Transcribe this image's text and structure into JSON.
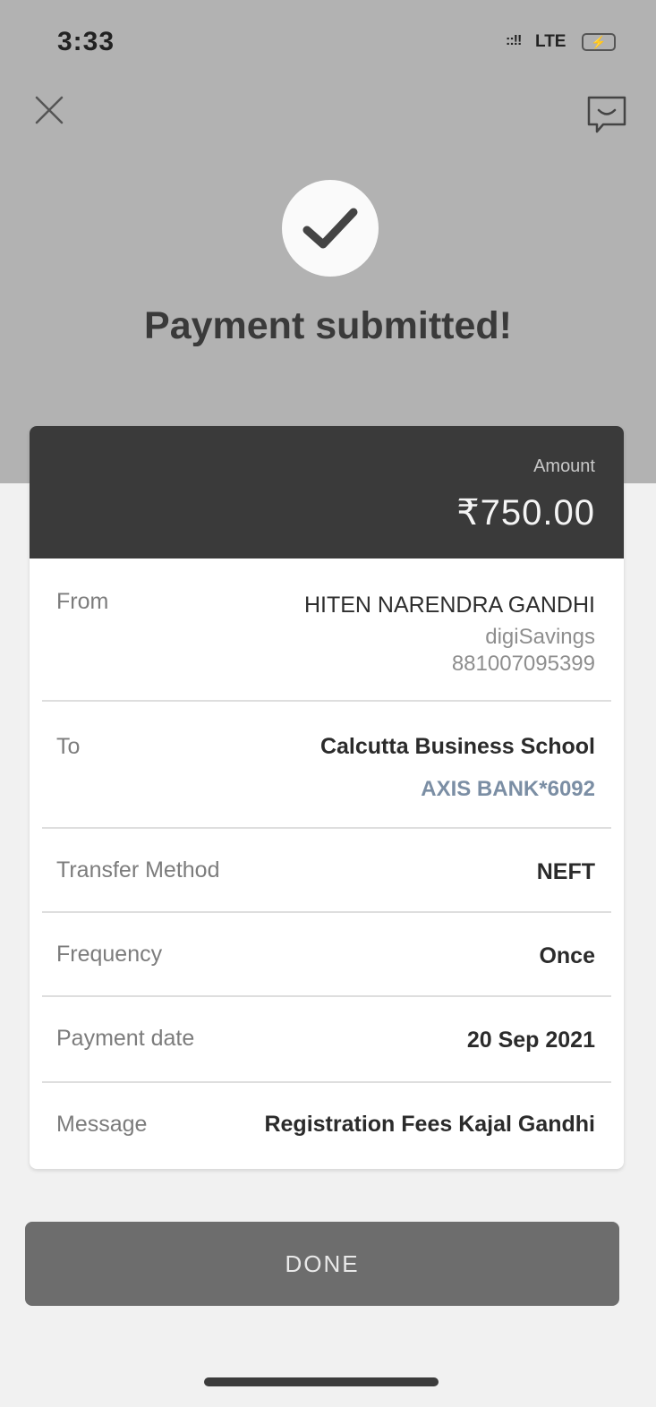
{
  "status_bar": {
    "time": "3:33",
    "signal": "::!!",
    "network": "LTE",
    "battery": "⚡"
  },
  "header": {
    "close_icon": "close-icon",
    "chat_icon": "chat-icon"
  },
  "confirmation": {
    "icon": "check-icon",
    "title": "Payment submitted!"
  },
  "amount": {
    "label": "Amount",
    "value": "₹750.00"
  },
  "details": {
    "from": {
      "label": "From",
      "name": "HITEN NARENDRA GANDHI",
      "account_type": "digiSavings",
      "account_number": "881007095399"
    },
    "to": {
      "label": "To",
      "name": "Calcutta Business School",
      "bank": "AXIS BANK*6092"
    },
    "transfer_method": {
      "label": "Transfer Method",
      "value": "NEFT"
    },
    "frequency": {
      "label": "Frequency",
      "value": "Once"
    },
    "payment_date": {
      "label": "Payment date",
      "value": "20 Sep 2021"
    },
    "message": {
      "label": "Message",
      "value": "Registration Fees Kajal Gandhi"
    }
  },
  "done_button": {
    "label": "DONE"
  },
  "colors": {
    "header_band": "#b2b2b2",
    "amount_box": "#3a3a3a",
    "button": "#6d6d6d",
    "bank_text": "#7b8ea4"
  }
}
